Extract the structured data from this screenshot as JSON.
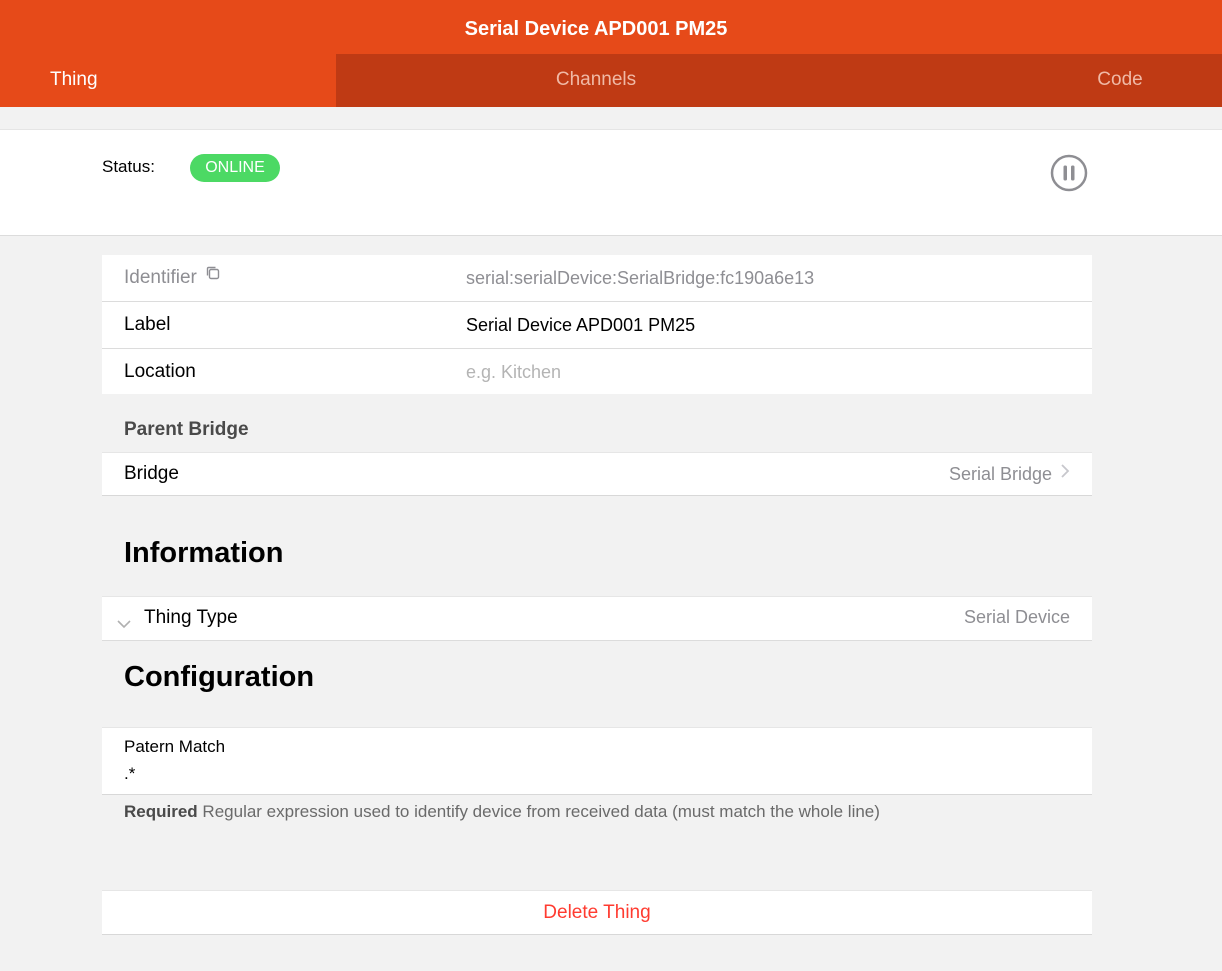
{
  "header": {
    "title": "Serial Device APD001 PM25",
    "tabs": [
      {
        "label": "Thing",
        "active": true
      },
      {
        "label": "Channels",
        "active": false
      },
      {
        "label": "Code",
        "active": false
      }
    ]
  },
  "status": {
    "label": "Status:",
    "value": "ONLINE",
    "value_color": "#4cd964",
    "pause_icon": "pause-circle-icon"
  },
  "details": {
    "identifier_label": "Identifier",
    "identifier_value": "serial:serialDevice:SerialBridge:fc190a6e13",
    "label_label": "Label",
    "label_value": "Serial Device APD001 PM25",
    "location_label": "Location",
    "location_placeholder": "e.g. Kitchen"
  },
  "parent_bridge": {
    "title": "Parent Bridge",
    "bridge_label": "Bridge",
    "bridge_value": "Serial Bridge"
  },
  "information": {
    "title": "Information",
    "thing_type_label": "Thing Type",
    "thing_type_value": "Serial Device"
  },
  "configuration": {
    "title": "Configuration",
    "pattern_label": "Patern Match",
    "pattern_value": ".*",
    "help_required": "Required",
    "help_text": "Regular expression used to identify device from received data (must match the whole line)"
  },
  "actions": {
    "delete_label": "Delete Thing",
    "delete_color": "#ff3b30"
  },
  "colors": {
    "accent": "#e64a19",
    "tab_inactive_bg": "#bf3a14"
  }
}
